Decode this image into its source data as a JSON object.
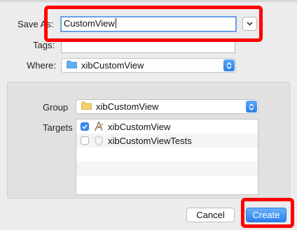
{
  "form": {
    "save_as_label": "Save As:",
    "save_as_value": "CustomView",
    "tags_label": "Tags:",
    "tags_value": "",
    "where_label": "Where:",
    "where_value": "xibCustomView"
  },
  "options": {
    "group_label": "Group",
    "group_value": "xibCustomView",
    "targets_label": "Targets",
    "targets": [
      {
        "label": "xibCustomView",
        "checked": true,
        "icon": "xcode-app-icon"
      },
      {
        "label": "xibCustomViewTests",
        "checked": false,
        "icon": "shield-icon"
      }
    ]
  },
  "buttons": {
    "cancel": "Cancel",
    "create": "Create"
  },
  "colors": {
    "accent": "#2d80ee",
    "highlight": "#ff0000",
    "folder": "#5fb0f2"
  }
}
